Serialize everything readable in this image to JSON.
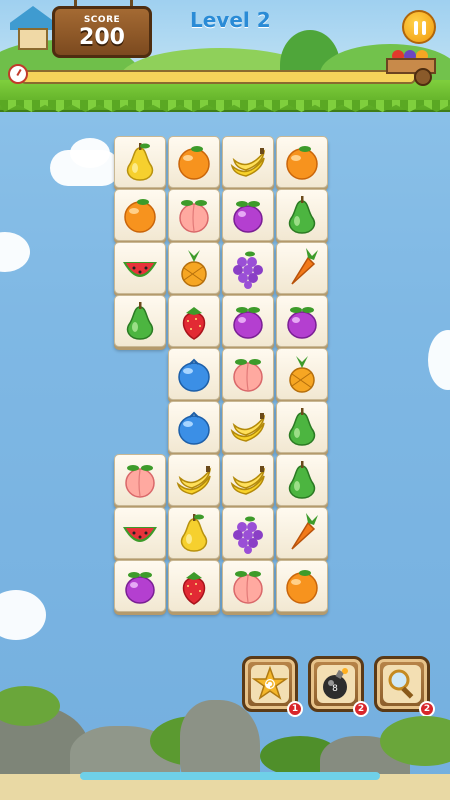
{
  "header": {
    "score_label": "SCORE",
    "score_value": "200",
    "level_title": "Level 2",
    "progress": 1.0
  },
  "board": {
    "columns": 4,
    "tiles": [
      {
        "col": 0,
        "row": 0,
        "fruit": "pear"
      },
      {
        "col": 1,
        "row": 0,
        "fruit": "orange"
      },
      {
        "col": 2,
        "row": 0,
        "fruit": "banana"
      },
      {
        "col": 3,
        "row": 0,
        "fruit": "orange"
      },
      {
        "col": 0,
        "row": 1,
        "fruit": "orange"
      },
      {
        "col": 1,
        "row": 1,
        "fruit": "peach"
      },
      {
        "col": 2,
        "row": 1,
        "fruit": "plum"
      },
      {
        "col": 3,
        "row": 1,
        "fruit": "green-pear"
      },
      {
        "col": 0,
        "row": 2,
        "fruit": "watermelon"
      },
      {
        "col": 1,
        "row": 2,
        "fruit": "pineapple"
      },
      {
        "col": 2,
        "row": 2,
        "fruit": "grapes"
      },
      {
        "col": 3,
        "row": 2,
        "fruit": "carrot"
      },
      {
        "col": 0,
        "row": 3,
        "fruit": "green-pear"
      },
      {
        "col": 1,
        "row": 3,
        "fruit": "strawberry"
      },
      {
        "col": 2,
        "row": 3,
        "fruit": "plum"
      },
      {
        "col": 3,
        "row": 3,
        "fruit": "plum"
      },
      {
        "col": 1,
        "row": 4,
        "fruit": "blueberry"
      },
      {
        "col": 2,
        "row": 4,
        "fruit": "peach"
      },
      {
        "col": 3,
        "row": 4,
        "fruit": "pineapple"
      },
      {
        "col": 1,
        "row": 5,
        "fruit": "blueberry"
      },
      {
        "col": 2,
        "row": 5,
        "fruit": "banana"
      },
      {
        "col": 3,
        "row": 5,
        "fruit": "green-pear"
      },
      {
        "col": 0,
        "row": 6,
        "fruit": "peach"
      },
      {
        "col": 1,
        "row": 6,
        "fruit": "banana"
      },
      {
        "col": 2,
        "row": 6,
        "fruit": "banana"
      },
      {
        "col": 3,
        "row": 6,
        "fruit": "green-pear"
      },
      {
        "col": 0,
        "row": 7,
        "fruit": "watermelon"
      },
      {
        "col": 1,
        "row": 7,
        "fruit": "pear"
      },
      {
        "col": 2,
        "row": 7,
        "fruit": "grapes"
      },
      {
        "col": 3,
        "row": 7,
        "fruit": "carrot"
      },
      {
        "col": 0,
        "row": 8,
        "fruit": "plum"
      },
      {
        "col": 1,
        "row": 8,
        "fruit": "strawberry"
      },
      {
        "col": 2,
        "row": 8,
        "fruit": "peach"
      },
      {
        "col": 3,
        "row": 8,
        "fruit": "orange"
      }
    ]
  },
  "boosters": [
    {
      "name": "shuffle-booster",
      "icon": "shuffle-star-icon",
      "count": "1"
    },
    {
      "name": "bomb-booster",
      "icon": "bomb-icon",
      "count": "2"
    },
    {
      "name": "hint-booster",
      "icon": "magnifier-icon",
      "count": "2"
    }
  ],
  "colors": {
    "sky": "#7fb8e4",
    "score_board": "#8a5524",
    "level_text": "#2a8bd6",
    "badge": "#d8262b",
    "pause": "#f29a0c"
  }
}
